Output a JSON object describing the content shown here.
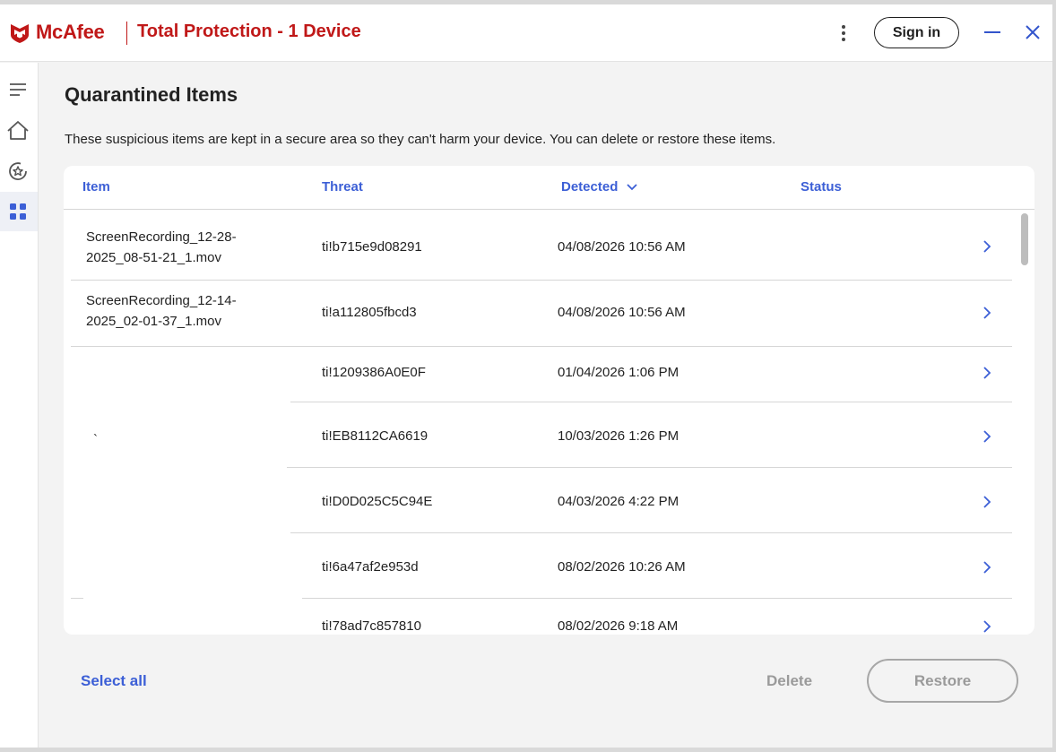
{
  "app": {
    "brand": "McAfee",
    "product": "Total Protection - 1 Device",
    "sign_in": "Sign in",
    "colors": {
      "brand_red": "#c01818",
      "accent_blue": "#3c5fd6"
    }
  },
  "sidebar": {
    "items": [
      {
        "icon": "menu-icon"
      },
      {
        "icon": "home-icon"
      },
      {
        "icon": "protection-star-icon"
      },
      {
        "icon": "apps-grid-icon",
        "active": true
      }
    ]
  },
  "page": {
    "title": "Quarantined Items",
    "description": "These suspicious items are kept in a secure area so they can't harm your device. You can delete or restore these items."
  },
  "table": {
    "columns": [
      "Item",
      "Threat",
      "Detected",
      "Status"
    ],
    "sorted_by": "Detected",
    "rows": [
      {
        "item_l1": "ScreenRecording_12-28-",
        "item_l2": "2025_08-51-21_1.mov",
        "threat": "ti!b715e9d08291",
        "detected": "04/08/2026 10:56 AM"
      },
      {
        "item_l1": "ScreenRecording_12-14-",
        "item_l2": "2025_02-01-37_1.mov",
        "threat": "ti!a112805fbcd3",
        "detected": "04/08/2026 10:56 AM"
      },
      {
        "item_l1": "",
        "item_l2": "",
        "threat": "ti!1209386A0E0F",
        "detected": "01/04/2026 1:06 PM"
      },
      {
        "item_l1": "`",
        "item_l2": "",
        "threat": "ti!EB8112CA6619",
        "detected": "10/03/2026 1:26 PM"
      },
      {
        "item_l1": "",
        "item_l2": "",
        "threat": "ti!D0D025C5C94E",
        "detected": "04/03/2026 4:22 PM"
      },
      {
        "item_l1": "",
        "item_l2": "",
        "threat": "ti!6a47af2e953d",
        "detected": "08/02/2026 10:26 AM"
      },
      {
        "item_l1": "",
        "item_l2": "",
        "threat": "ti!78ad7c857810",
        "detected": "08/02/2026 9:18 AM"
      }
    ]
  },
  "footer": {
    "select_all": "Select all",
    "delete": "Delete",
    "restore": "Restore"
  }
}
